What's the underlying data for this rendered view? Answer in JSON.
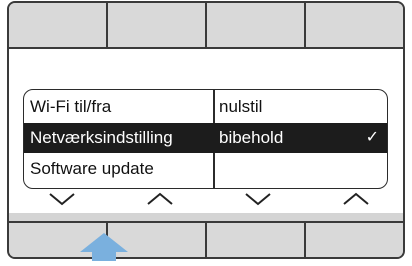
{
  "softkeys_top": [
    "",
    "",
    "",
    ""
  ],
  "softkeys_bottom": [
    "",
    "",
    "",
    ""
  ],
  "menu": {
    "left_items": [
      {
        "label": "Wi-Fi til/fra",
        "selected": false
      },
      {
        "label": "Netværksindstilling",
        "selected": true
      },
      {
        "label": "Software update",
        "selected": false
      }
    ],
    "right_items": [
      {
        "label": "nulstil",
        "checked": false
      },
      {
        "label": "bibehold",
        "checked": true
      },
      {
        "label": "",
        "checked": false
      }
    ],
    "check_glyph": "✓"
  },
  "nav_arrows": [
    "chevron-down-icon",
    "chevron-up-icon",
    "chevron-down-icon",
    "chevron-up-icon"
  ],
  "colors": {
    "selection": "#1c1c1c",
    "indicator": "#7ab0de",
    "bezel": "#d4d4d4"
  }
}
